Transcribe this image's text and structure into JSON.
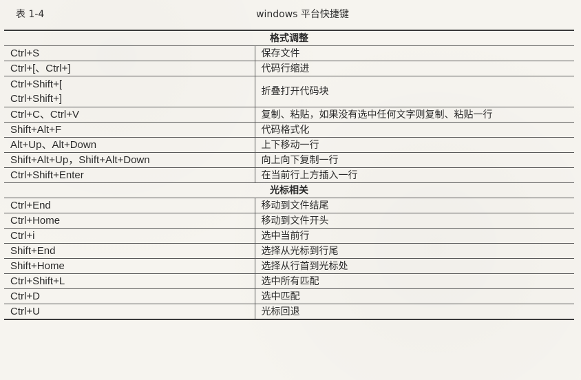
{
  "caption": {
    "number": "表 1-4",
    "title": "windows 平台快捷键"
  },
  "sections": [
    {
      "title": "格式调整",
      "rows": [
        {
          "keys": "Ctrl+S",
          "desc": "保存文件"
        },
        {
          "keys": "Ctrl+[、Ctrl+]",
          "desc": "代码行缩进"
        },
        {
          "keys_lines": [
            "Ctrl+Shift+[",
            "Ctrl+Shift+]"
          ],
          "desc": "折叠打开代码块"
        },
        {
          "keys": "Ctrl+C、Ctrl+V",
          "desc": "复制、粘贴，如果没有选中任何文字则复制、粘贴一行"
        },
        {
          "keys": "Shift+Alt+F",
          "desc": "代码格式化"
        },
        {
          "keys": "Alt+Up、Alt+Down",
          "desc": "上下移动一行"
        },
        {
          "keys": "Shift+Alt+Up，Shift+Alt+Down",
          "desc": "向上向下复制一行"
        },
        {
          "keys": "Ctrl+Shift+Enter",
          "desc": "在当前行上方插入一行"
        }
      ]
    },
    {
      "title": "光标相关",
      "rows": [
        {
          "keys": "Ctrl+End",
          "desc": "移动到文件结尾"
        },
        {
          "keys": "Ctrl+Home",
          "desc": "移动到文件开头"
        },
        {
          "keys": "Ctrl+i",
          "desc": "选中当前行"
        },
        {
          "keys": "Shift+End",
          "desc": "选择从光标到行尾"
        },
        {
          "keys": "Shift+Home",
          "desc": "选择从行首到光标处"
        },
        {
          "keys": "Ctrl+Shift+L",
          "desc": "选中所有匹配"
        },
        {
          "keys": "Ctrl+D",
          "desc": "选中匹配"
        },
        {
          "keys": "Ctrl+U",
          "desc": "光标回退"
        }
      ]
    }
  ]
}
